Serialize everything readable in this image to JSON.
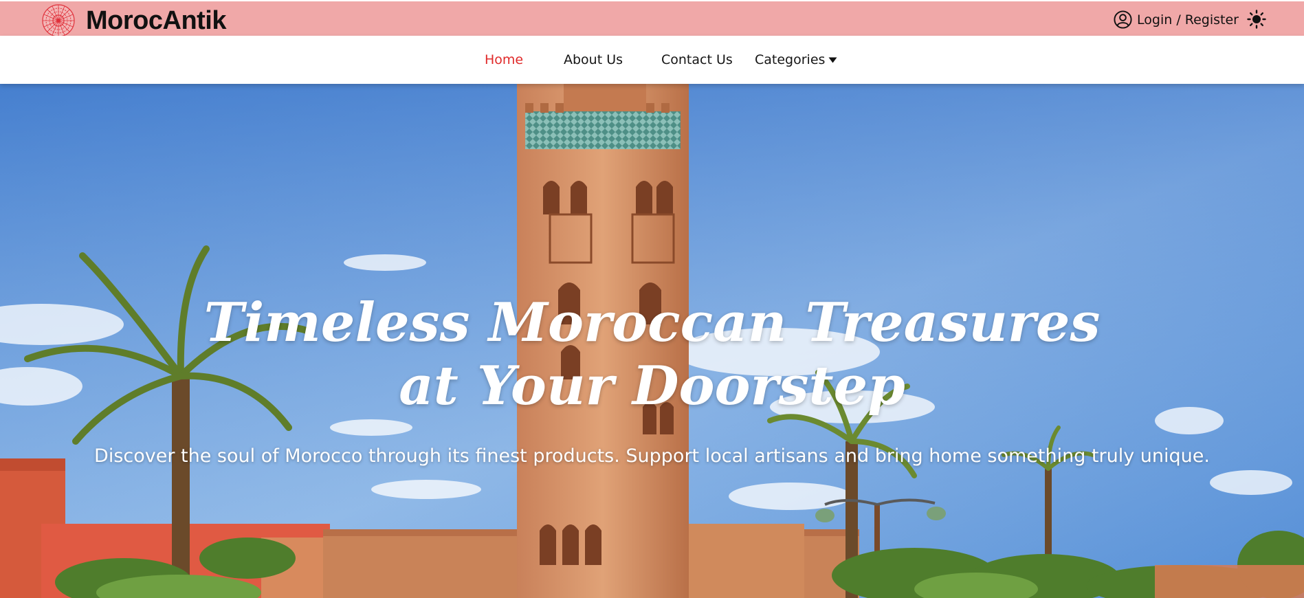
{
  "brand": {
    "name": "MorocAntik",
    "logo_icon": "mandala-logo-icon"
  },
  "header": {
    "auth_label": "Login / Register",
    "user_icon": "user-circle-icon",
    "theme_icon": "sun-icon"
  },
  "nav": {
    "items": [
      {
        "label": "Home",
        "active": true
      },
      {
        "label": "About Us",
        "active": false
      },
      {
        "label": "Contact Us",
        "active": false
      },
      {
        "label": "Categories",
        "active": false,
        "icon": "caret-down-icon"
      }
    ]
  },
  "hero": {
    "title_line1": "Timeless Moroccan Treasures",
    "title_line2": "at Your Doorstep",
    "subtitle": "Discover the soul of Morocco through its finest products. Support local artisans and bring home something truly unique.",
    "background": "photo of the Koutoubia minaret in Marrakech with palm trees and blue sky"
  },
  "colors": {
    "topbar": "#f0a8a8",
    "active_link": "#e02a2a",
    "text": "#111111",
    "logo": "#e0303a",
    "sky_top": "#3a7ad0",
    "sky_bottom": "#a9c9ee",
    "minaret": "#d4936a"
  }
}
